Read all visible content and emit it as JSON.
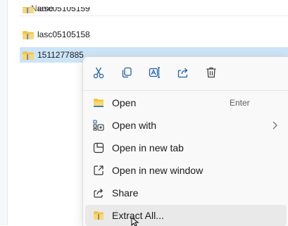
{
  "file_list": {
    "column_name": "Name",
    "partial_item": "lasc05105159",
    "items": [
      {
        "name": "lasc05105158",
        "icon": "zip-folder-icon"
      },
      {
        "name": "1511277885",
        "icon": "zip-folder-icon",
        "selected": true
      }
    ]
  },
  "context_menu": {
    "toolbar": [
      {
        "name": "cut",
        "icon": "scissors-icon"
      },
      {
        "name": "copy",
        "icon": "copy-icon"
      },
      {
        "name": "rename",
        "icon": "rename-icon"
      },
      {
        "name": "share",
        "icon": "share-icon"
      },
      {
        "name": "delete",
        "icon": "trash-icon"
      }
    ],
    "items": [
      {
        "label": "Open",
        "shortcut": "Enter",
        "icon": "folder-icon"
      },
      {
        "label": "Open with",
        "submenu": true,
        "icon": "open-with-icon"
      },
      {
        "label": "Open in new tab",
        "icon": "new-tab-icon"
      },
      {
        "label": "Open in new window",
        "icon": "new-window-icon"
      },
      {
        "label": "Share",
        "icon": "share-icon"
      },
      {
        "label": "Extract All...",
        "icon": "extract-icon",
        "hovered": true
      }
    ]
  },
  "colors": {
    "accent": "#0067c0",
    "selection": "#cce4f7",
    "menu_background": "#f9f9f9",
    "folder_yellow": "#f4c542"
  }
}
